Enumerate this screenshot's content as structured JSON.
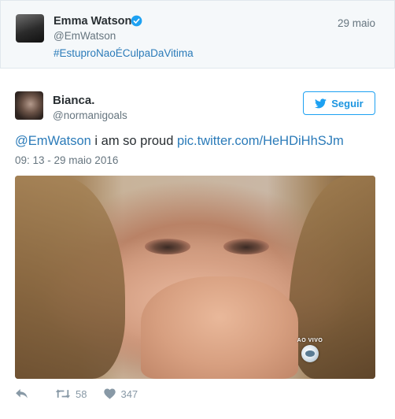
{
  "parent_tweet": {
    "name": "Emma Watson",
    "handle": "@EmWatson",
    "date": "29 maio",
    "hashtag": "#EstuproNaoÉCulpaDaVitima"
  },
  "tweet": {
    "name": "Bianca.",
    "handle": "@normanigoals",
    "follow_label": "Seguir",
    "text_mention": "@EmWatson",
    "text_body": " i am so proud ",
    "text_link": "pic.twitter.com/HeHDiHhSJm",
    "timestamp": "09: 13 - 29 maio 2016",
    "media_overlay": "AO VIVO",
    "retweets": "58",
    "likes": "347"
  },
  "colors": {
    "accent": "#1da1f2",
    "link": "#2b7bb9",
    "muted": "#66757f",
    "icon": "#8899a6"
  },
  "icons": [
    "verified-icon",
    "twitter-bird-icon",
    "reply-icon",
    "retweet-icon",
    "heart-icon",
    "globo-logo-icon"
  ]
}
